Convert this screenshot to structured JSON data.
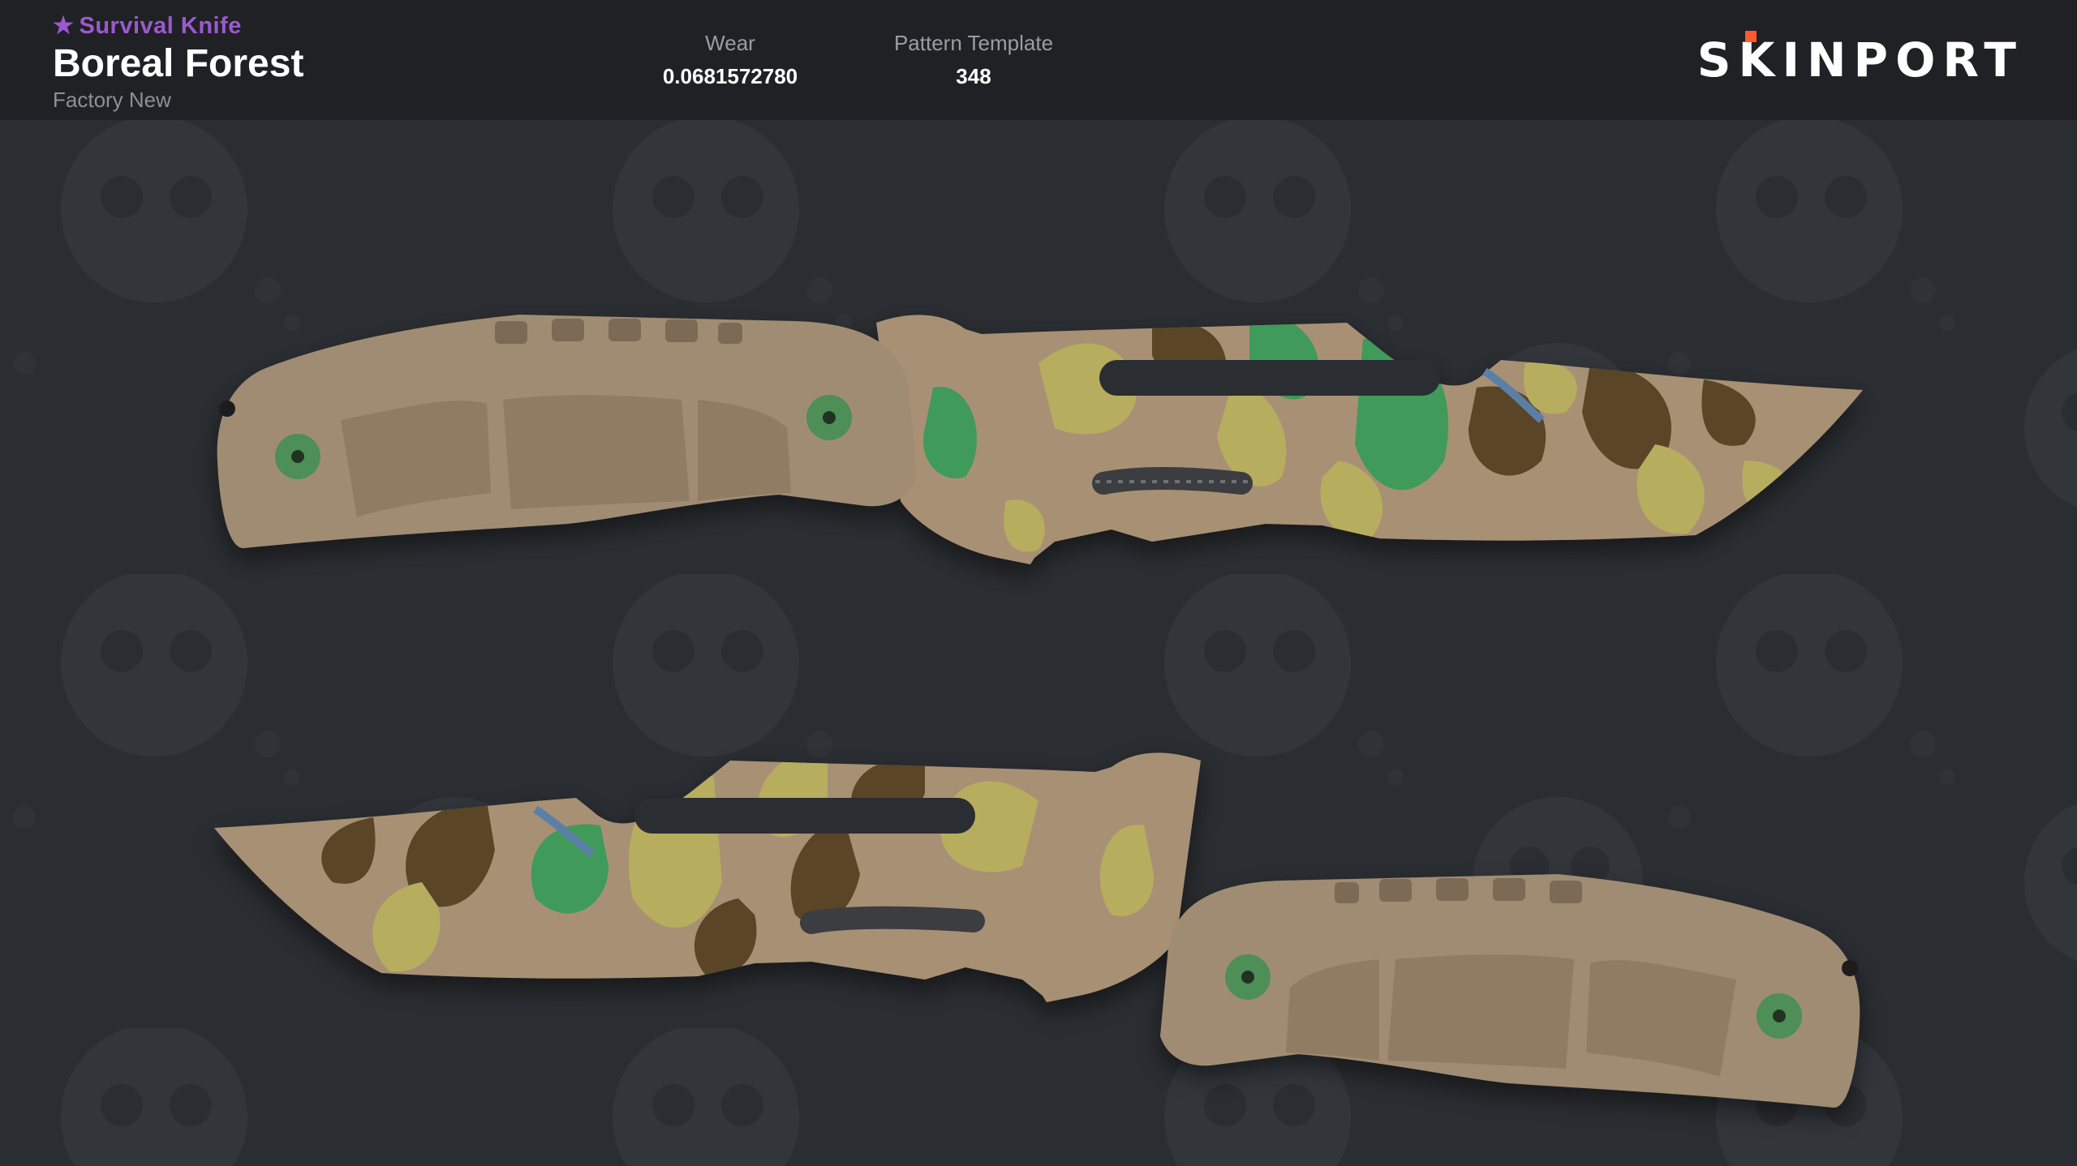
{
  "item": {
    "category": "Survival Knife",
    "category_icon": "star-icon",
    "name": "Boreal Forest",
    "exterior": "Factory New"
  },
  "stats": {
    "wear_label": "Wear",
    "wear_value": "0.0681572780",
    "pattern_label": "Pattern Template",
    "pattern_value": "348"
  },
  "brand": {
    "logo_pre": "S",
    "logo_mid": "K",
    "logo_post": "INPORT",
    "accent": "#ff5a2d"
  },
  "colors": {
    "header_bg": "#1f2124",
    "stage_bg": "#2a2d31",
    "category_purple": "#9b59d0",
    "handle": "#a08c73",
    "camo_tan": "#a89074",
    "camo_brown": "#5a4528",
    "camo_yellow": "#b7ad5f",
    "camo_green": "#3f9a5a"
  }
}
